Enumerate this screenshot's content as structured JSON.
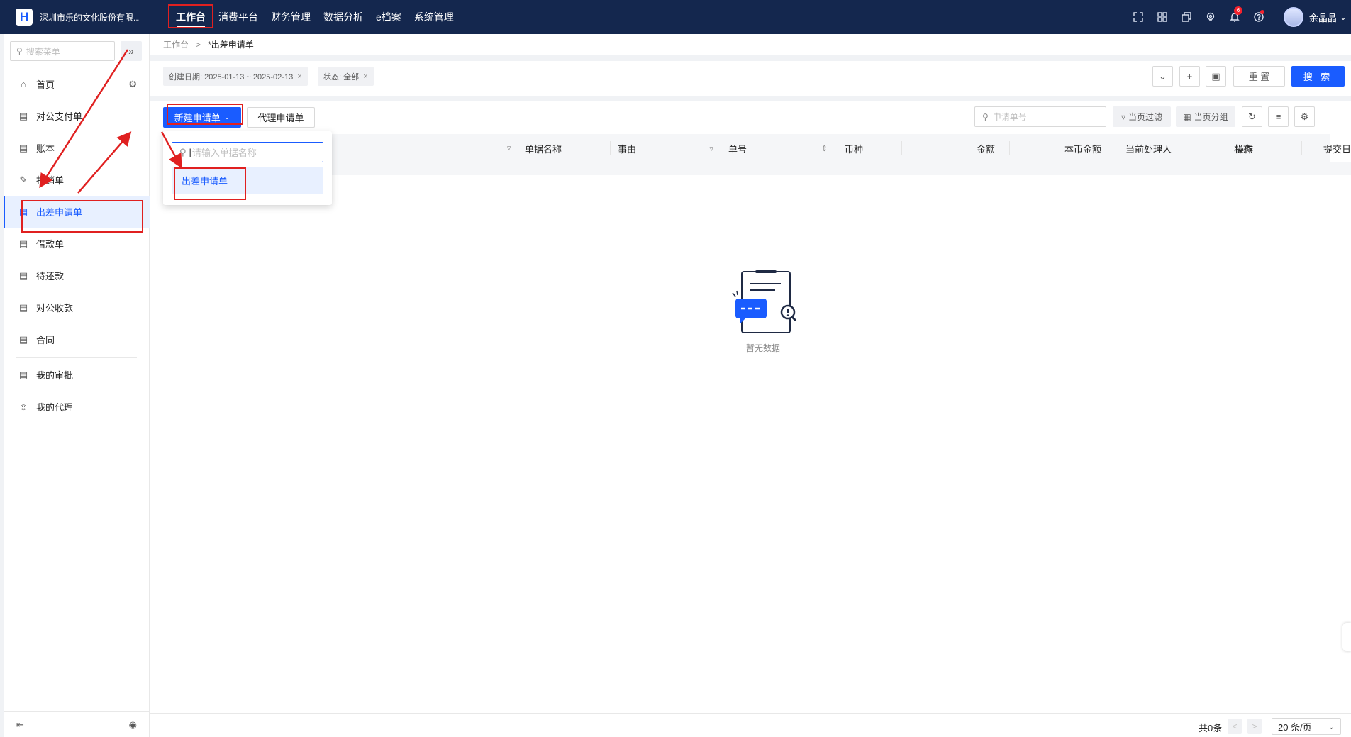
{
  "app": {
    "company": "深圳市乐的文化股份有限...",
    "logo_letter": "H"
  },
  "topnav": {
    "items": [
      {
        "label": "工作台",
        "active": true
      },
      {
        "label": "消费平台"
      },
      {
        "label": "财务管理"
      },
      {
        "label": "数据分析"
      },
      {
        "label": "e档案"
      },
      {
        "label": "系统管理"
      }
    ],
    "icons": [
      "fullscreen-icon",
      "grid-icon",
      "windows-icon",
      "location-icon",
      "bell-icon",
      "help-icon"
    ],
    "notification_count": "6",
    "user_name": "余晶晶"
  },
  "sidebar": {
    "search_placeholder": "搜索菜单",
    "items": [
      {
        "label": "首页",
        "icon": "home-icon"
      },
      {
        "label": "对公支付单",
        "icon": "payment-icon"
      },
      {
        "label": "账本",
        "icon": "ledger-icon"
      },
      {
        "label": "报销单",
        "icon": "reimburse-icon"
      },
      {
        "label": "出差申请单",
        "icon": "doc-icon",
        "active": true
      },
      {
        "label": "借款单",
        "icon": "loan-icon"
      },
      {
        "label": "待还款",
        "icon": "repay-icon"
      },
      {
        "label": "对公收款",
        "icon": "receipt-icon"
      },
      {
        "label": "合同",
        "icon": "contract-icon"
      },
      {
        "label": "我的审批",
        "icon": "approval-icon"
      },
      {
        "label": "我的代理",
        "icon": "agent-icon"
      }
    ]
  },
  "breadcrumb": {
    "root": "工作台",
    "current": "*出差申请单"
  },
  "filters": {
    "chips": [
      {
        "label": "创建日期: 2025-01-13 ~ 2025-02-13"
      },
      {
        "label": "状态: 全部"
      }
    ],
    "reset_label": "重 置",
    "search_label": "搜 索"
  },
  "toolbar": {
    "new_label": "新建申请单",
    "proxy_label": "代理申请单",
    "search_placeholder": "申请单号",
    "page_filter_label": "当页过滤",
    "page_group_label": "当页分组"
  },
  "table": {
    "columns": [
      "单据名称",
      "事由",
      "单号",
      "币种",
      "金额",
      "本币金额",
      "当前处理人",
      "状态",
      "提交日期",
      "操作"
    ]
  },
  "empty": {
    "text": "暂无数据"
  },
  "dropdown": {
    "placeholder": "请输入单据名称",
    "items": [
      "出差申请单"
    ]
  },
  "footer": {
    "total": "共0条",
    "page_size": "20 条/页"
  },
  "colors": {
    "topbar": "#14274e",
    "primary": "#1a5cff",
    "highlight": "#e02020"
  }
}
